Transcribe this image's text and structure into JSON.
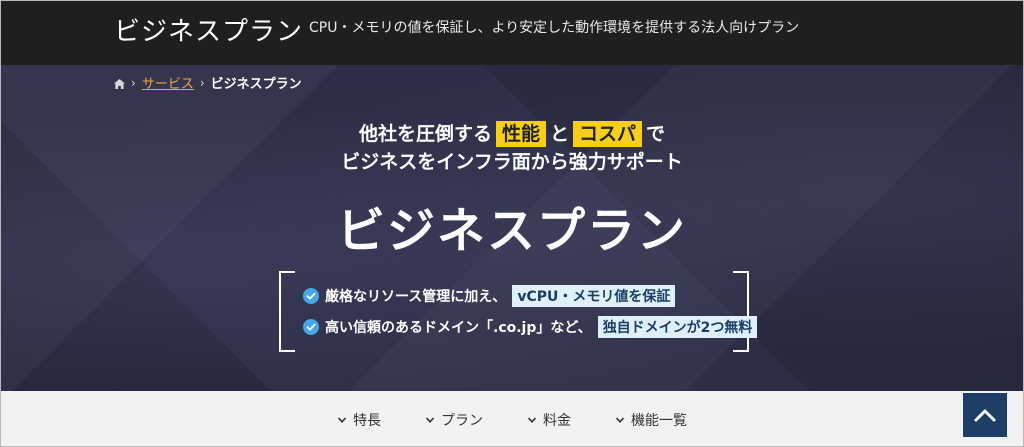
{
  "header": {
    "brand": "ビジネスプラン",
    "tagline": "CPU・メモリの値を保証し、より安定した動作環境を提供する法人向けプラン"
  },
  "breadcrumb": {
    "home_icon": "home-icon",
    "link": "サービス",
    "current": "ビジネスプラン"
  },
  "hero": {
    "line1_pre": "他社を圧倒する",
    "line1_hl1": "性能",
    "line1_mid": "と",
    "line1_hl2": "コスパ",
    "line1_post": "で",
    "line2": "ビジネスをインフラ面から強力サポート",
    "title": "ビジネスプラン",
    "features": [
      {
        "text": "厳格なリソース管理に加え、",
        "highlight": "vCPU・メモリ値を保証"
      },
      {
        "text": "高い信頼のあるドメイン「.co.jp」など、",
        "highlight": "独自ドメインが2つ無料"
      }
    ],
    "colors": {
      "bg": "#2d2e46",
      "accent_yellow": "#f7cf1b",
      "check_blue": "#45a7e6"
    }
  },
  "nav": {
    "items": [
      "特長",
      "プラン",
      "料金",
      "機能一覧"
    ]
  },
  "to_top": {
    "icon": "chevron-up-icon"
  }
}
